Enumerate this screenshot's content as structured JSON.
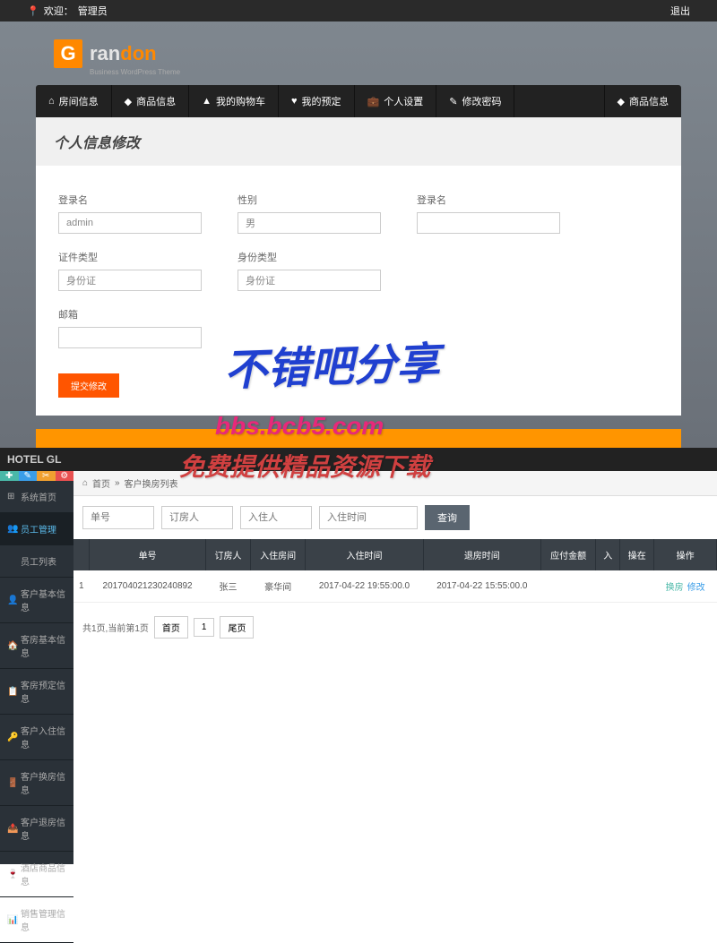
{
  "topbar": {
    "welcome_prefix": "欢迎：",
    "role": "管理员",
    "logout": "退出"
  },
  "logo": {
    "g": "G",
    "ran": "ran",
    "don": "don",
    "sub": "Business WordPress Theme"
  },
  "nav": {
    "items": [
      {
        "icon": "⌂",
        "label": "房间信息"
      },
      {
        "icon": "◆",
        "label": "商品信息"
      },
      {
        "icon": "▲",
        "label": "我的购物车"
      },
      {
        "icon": "♥",
        "label": "我的预定"
      },
      {
        "icon": "💼",
        "label": "个人设置"
      },
      {
        "icon": "✎",
        "label": "修改密码"
      }
    ],
    "right": {
      "icon": "◆",
      "label": "商品信息"
    }
  },
  "panel": {
    "title": "个人信息修改",
    "fields": {
      "login_label": "登录名",
      "login_value": "admin",
      "gender_label": "性别",
      "gender_value": "男",
      "login2_label": "登录名",
      "login2_value": "",
      "idtype_label": "证件类型",
      "idtype_value": "身份证",
      "idtype2_label": "身份类型",
      "idtype2_value": "身份证",
      "email_label": "邮箱",
      "email_value": ""
    },
    "submit": "提交修改"
  },
  "bottom_header": "HOTEL GL",
  "sidebar": {
    "items": [
      {
        "icon": "⊞",
        "label": "系统首页"
      },
      {
        "icon": "👥",
        "label": "员工管理",
        "active": true
      },
      {
        "icon": "",
        "label": "员工列表"
      },
      {
        "icon": "👤",
        "label": "客户基本信息"
      },
      {
        "icon": "🏠",
        "label": "客房基本信息"
      },
      {
        "icon": "📋",
        "label": "客房预定信息"
      },
      {
        "icon": "🔑",
        "label": "客户入住信息"
      },
      {
        "icon": "🚪",
        "label": "客户换房信息"
      },
      {
        "icon": "📤",
        "label": "客户退房信息"
      },
      {
        "icon": "🍷",
        "label": "酒店商品信息"
      },
      {
        "icon": "📊",
        "label": "销售管理信息"
      }
    ]
  },
  "breadcrumb": {
    "home": "首页",
    "sep": "»",
    "current": "客户换房列表"
  },
  "filter": {
    "order_ph": "单号",
    "booker_ph": "订房人",
    "checkin_ph": "入住人",
    "time_ph": "入住时间",
    "search": "查询"
  },
  "table": {
    "headers": [
      "",
      "单号",
      "订房人",
      "入住房间",
      "入住时间",
      "退房时间",
      "应付金额",
      "入",
      "操在",
      "操作"
    ],
    "rows": [
      {
        "idx": "1",
        "order": "201704021230240892",
        "booker": "张三",
        "room": "豪华间",
        "checkin": "2017-04-22 19:55:00.0",
        "checkout": "2017-04-22 15:55:00.0",
        "amount": "",
        "c7": "",
        "c8": "",
        "act1": "换房",
        "act2": "修改"
      }
    ]
  },
  "pagination": {
    "info": "共1页,当前第1页",
    "first": "首页",
    "num": "1",
    "last": "尾页"
  },
  "watermark": {
    "line1": "不错吧分享",
    "line2": "bbs.bcb5.com",
    "line3": "免费提供精品资源下载"
  }
}
